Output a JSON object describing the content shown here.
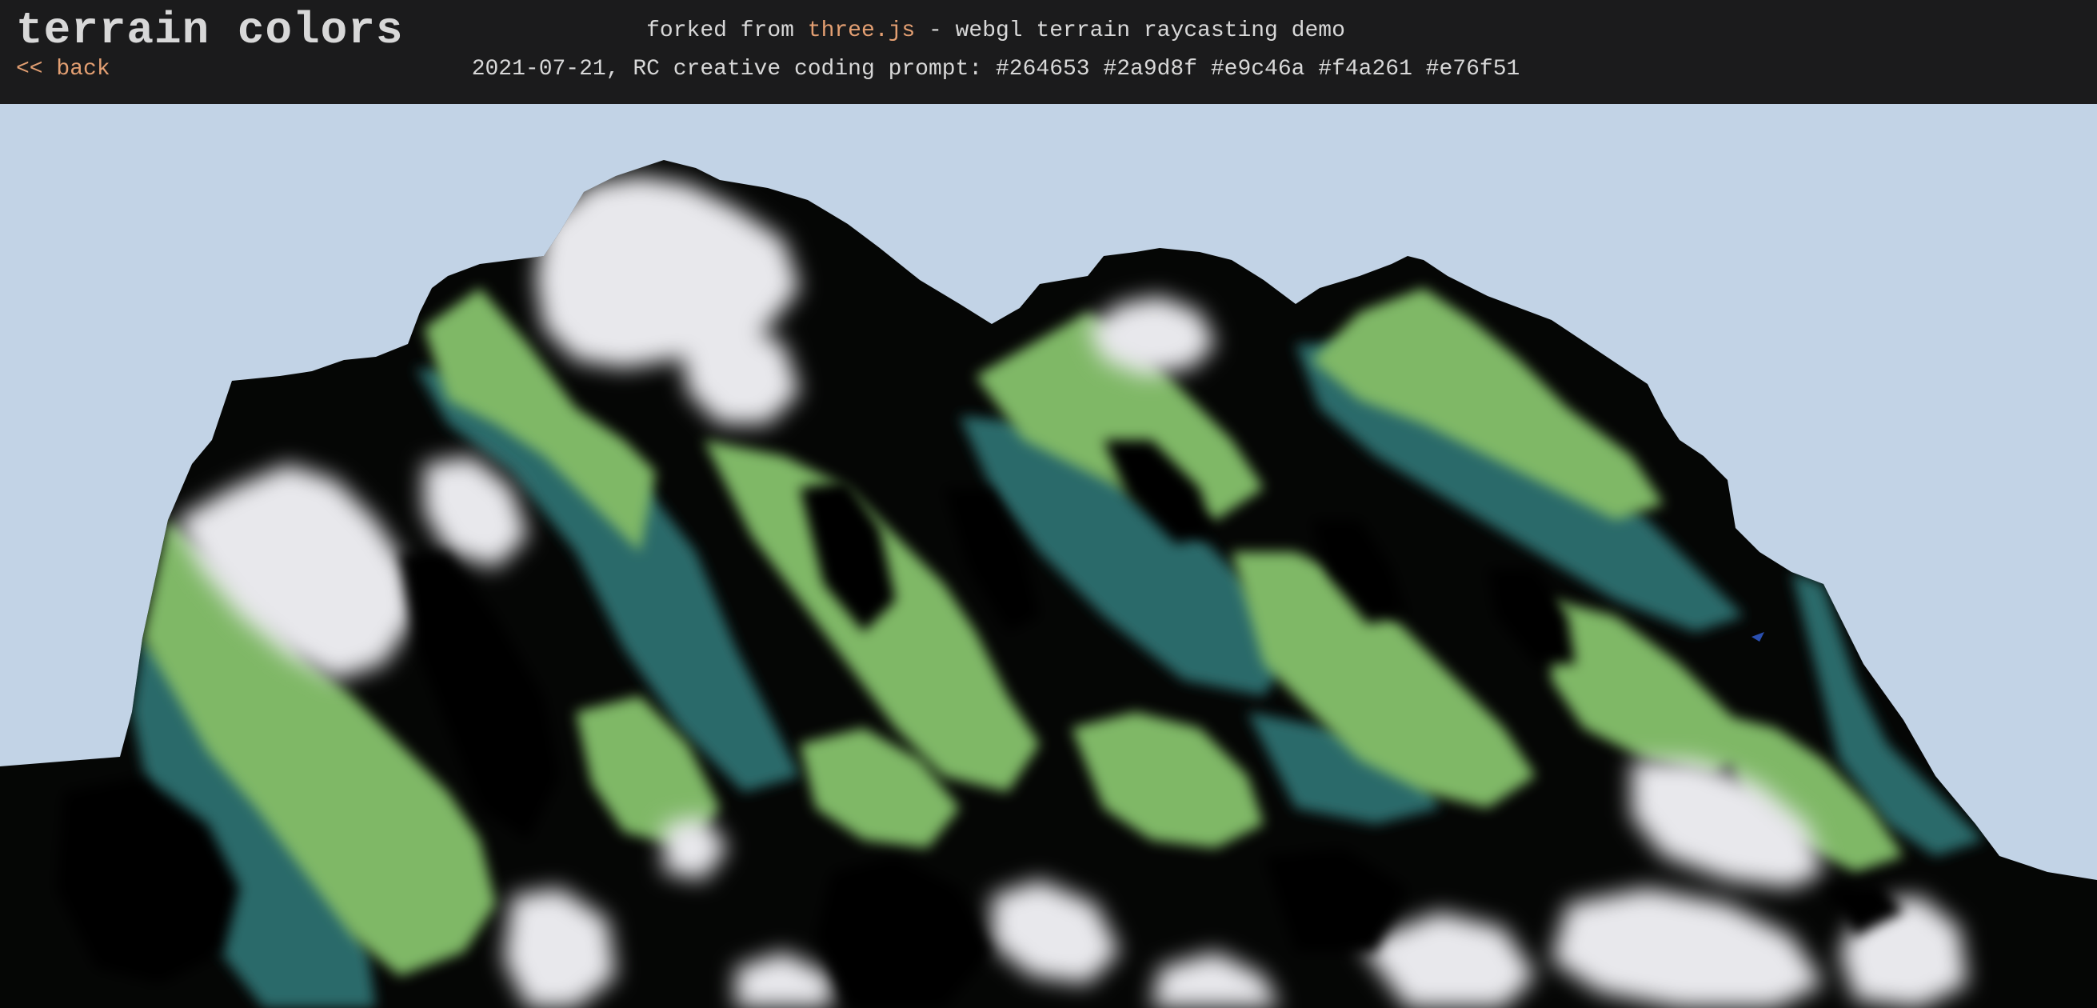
{
  "header": {
    "title": "terrain colors",
    "back_label": "<< back",
    "forked_prefix": "forked from ",
    "forked_link": "three.js",
    "forked_suffix": " - webgl terrain raycasting demo",
    "prompt_line": "2021-07-21, RC creative coding prompt: #264653 #2a9d8f #e9c46a #f4a261 #e76f51"
  },
  "colors": {
    "header_bg": "#1b1b1c",
    "header_text": "#d8d8d8",
    "link": "#e39f72",
    "sky": "#c2d3e6",
    "terrain_teal": "#2a6a6a",
    "terrain_green": "#7fb866",
    "terrain_snow": "#e8e8ec",
    "shadow": "#050605"
  }
}
